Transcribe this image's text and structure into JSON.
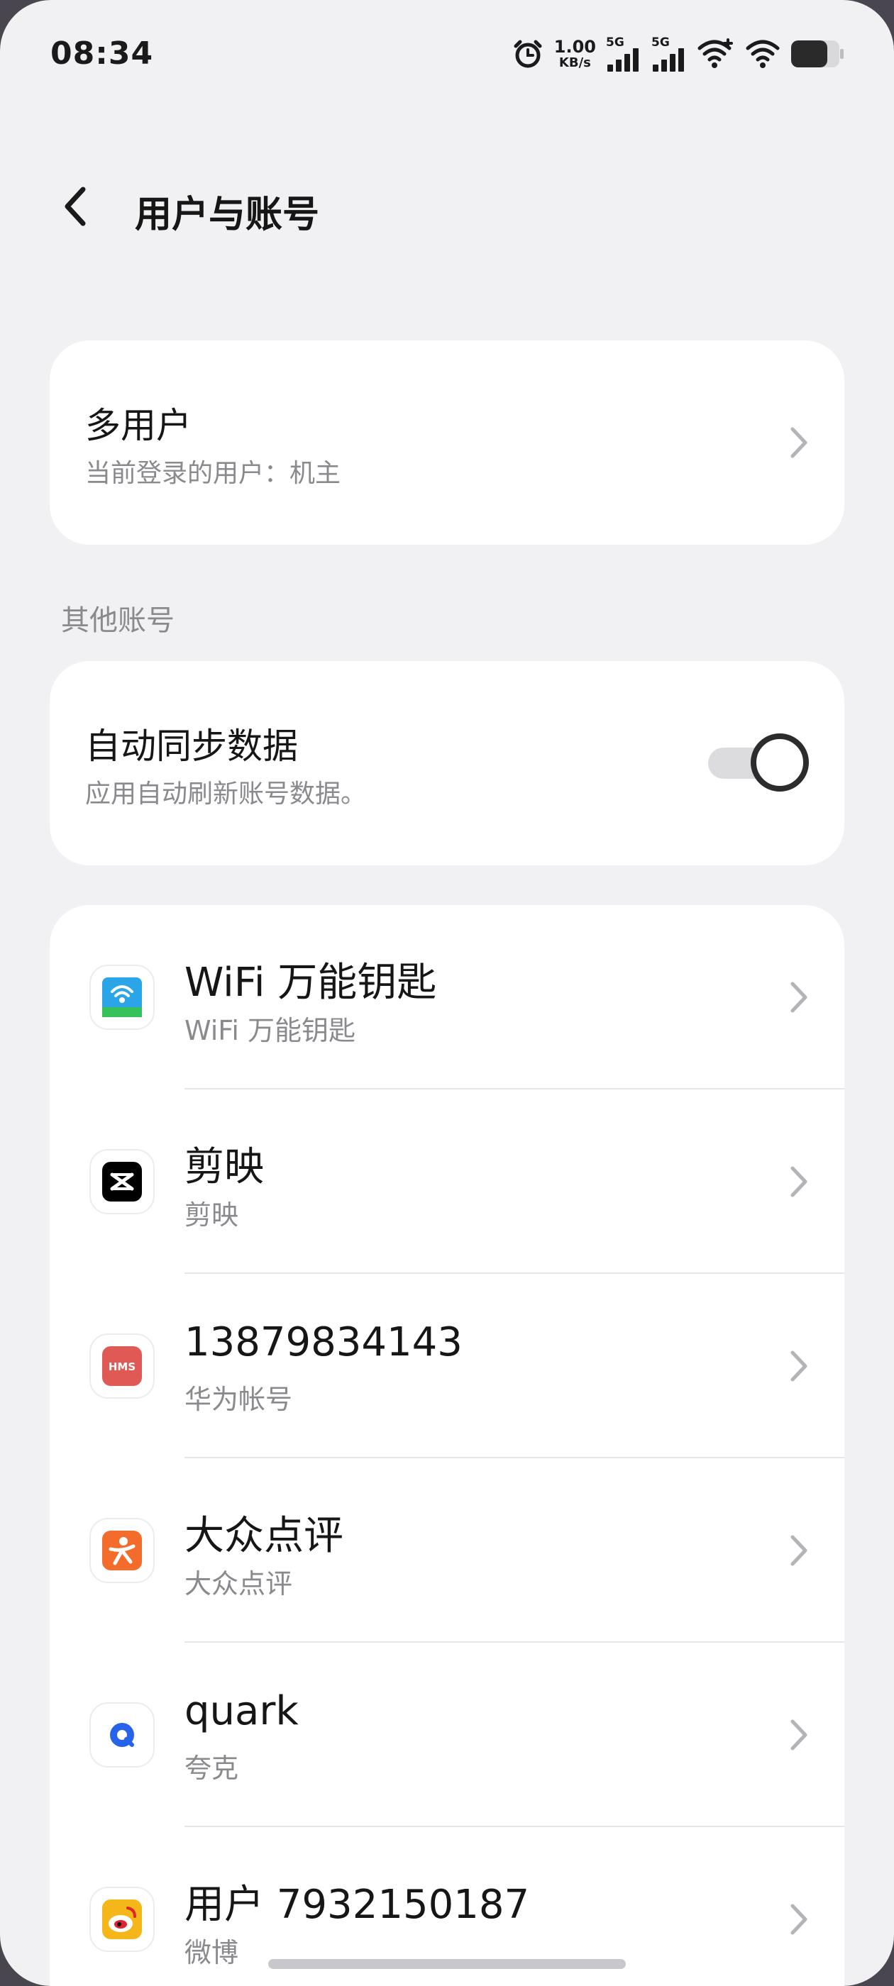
{
  "status_bar": {
    "time": "08:34",
    "speed_value": "1.00",
    "speed_unit": "KB/s",
    "sim1_label": "5G",
    "sim2_label": "5G",
    "battery_level": 0.75
  },
  "header": {
    "title": "用户与账号"
  },
  "multi_user": {
    "title": "多用户",
    "subtitle": "当前登录的用户：机主"
  },
  "other_accounts": {
    "section_label": "其他账号",
    "auto_sync": {
      "title": "自动同步数据",
      "subtitle": "应用自动刷新账号数据。",
      "enabled": true
    }
  },
  "accounts": [
    {
      "name": "WiFi 万能钥匙",
      "sub": "WiFi 万能钥匙",
      "icon": "wifi-key-app-icon",
      "color": "#2aa6e8"
    },
    {
      "name": "剪映",
      "sub": "剪映",
      "icon": "capcut-app-icon",
      "color": "#000000"
    },
    {
      "name": "13879834143",
      "sub": "华为帐号",
      "icon": "hms-app-icon",
      "color": "#e05a55",
      "icon_text": "HMS"
    },
    {
      "name": "大众点评",
      "sub": "大众点评",
      "icon": "dianping-app-icon",
      "color": "#f46c2c"
    },
    {
      "name": "quark",
      "sub": "夸克",
      "icon": "quark-app-icon",
      "color": "#2563eb"
    },
    {
      "name": "用户 7932150187",
      "sub": "微博",
      "icon": "weibo-app-icon",
      "color": "#f5b61a"
    }
  ]
}
